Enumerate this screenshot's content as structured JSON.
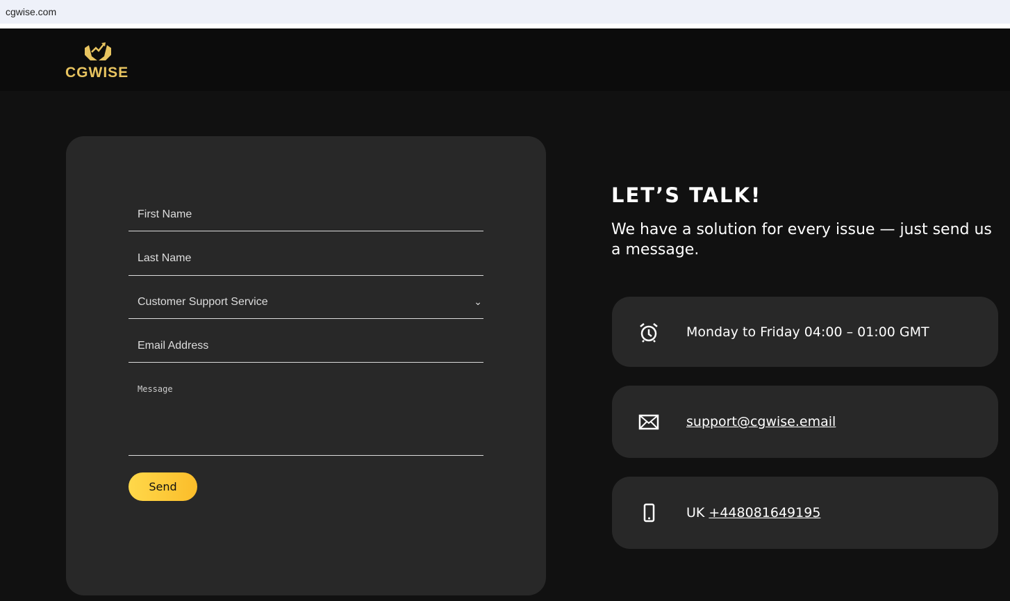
{
  "browser": {
    "url": "cgwise.com"
  },
  "brand": {
    "logo_text": "CGWISE",
    "accent": "#e8c460"
  },
  "form": {
    "first_name": "First Name",
    "last_name": "Last Name",
    "department": "Customer Support Service",
    "email": "Email Address",
    "message": "Message",
    "send": "Send"
  },
  "contact": {
    "title": "LET’S TALK!",
    "subtitle": "We have a solution for every issue — just send us a message.",
    "hours": "Monday to Friday 04:00 – 01:00 GMT",
    "email": "support@cgwise.email",
    "phone_prefix": "UK",
    "phone": "+448081649195"
  }
}
